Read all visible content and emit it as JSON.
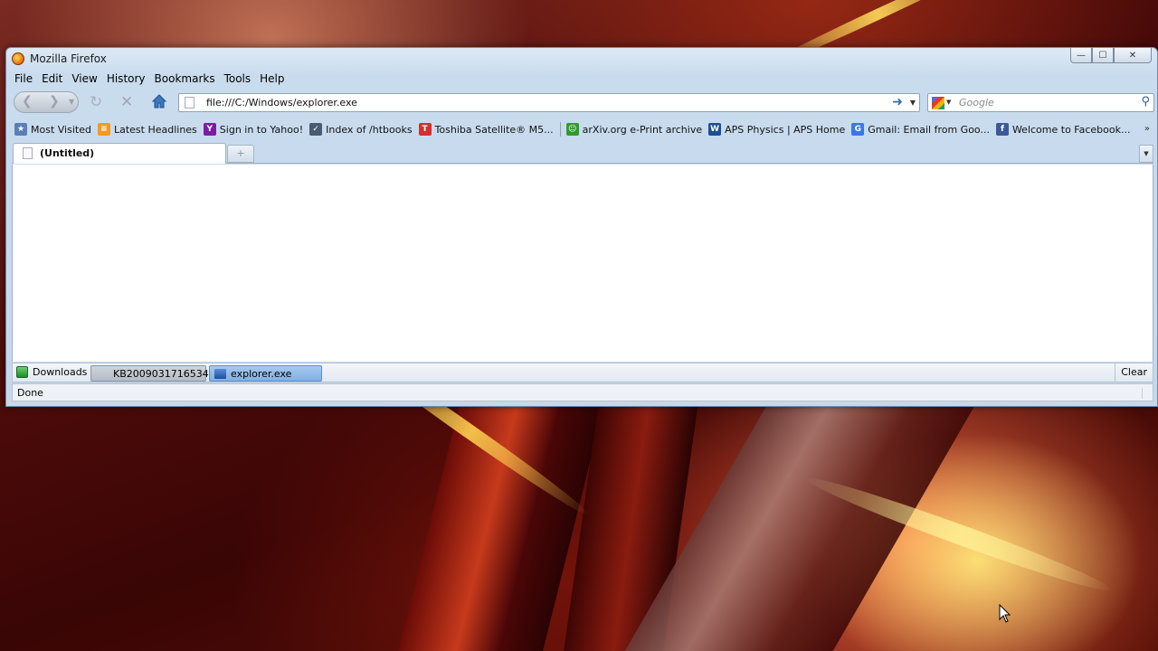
{
  "window": {
    "title": "Mozilla Firefox",
    "buttons": {
      "minimize": "—",
      "maximize": "☐",
      "close": "✕"
    }
  },
  "menu": [
    {
      "label": "File"
    },
    {
      "label": "Edit"
    },
    {
      "label": "View"
    },
    {
      "label": "History"
    },
    {
      "label": "Bookmarks"
    },
    {
      "label": "Tools"
    },
    {
      "label": "Help"
    }
  ],
  "navigation": {
    "url": "file:///C:/Windows/explorer.exe",
    "search_placeholder": "Google",
    "back_glyph": "❮",
    "forward_glyph": "❯",
    "reload_glyph": "↻",
    "stop_glyph": "✕",
    "go_glyph": "➜",
    "search_glyph": "⚲"
  },
  "bookmarks": [
    {
      "label": "Most Visited",
      "icon": "most-visited-icon",
      "color": "#5a7fb8",
      "glyph": "★"
    },
    {
      "label": "Latest Headlines",
      "icon": "rss-feed-icon",
      "color": "#f29a20",
      "glyph": "≡"
    },
    {
      "label": "Sign in to Yahoo!",
      "icon": "yahoo-icon",
      "color": "#7b1fa2",
      "glyph": "Y"
    },
    {
      "label": "Index of /htbooks",
      "icon": "folder-index-icon",
      "color": "#4a5a72",
      "glyph": "✓"
    },
    {
      "label": "Toshiba Satellite® M5...",
      "icon": "toshiba-icon",
      "color": "#d32f2f",
      "glyph": "T"
    },
    {
      "label": "arXiv.org e-Print archive",
      "icon": "arxiv-icon",
      "color": "#2e9b2e",
      "glyph": "☺"
    },
    {
      "label": "APS Physics | APS Home",
      "icon": "aps-icon",
      "color": "#1c4f96",
      "glyph": "W"
    },
    {
      "label": "Gmail: Email from Goo...",
      "icon": "gmail-icon",
      "color": "#3b78e7",
      "glyph": "G"
    },
    {
      "label": "Welcome to Facebook...",
      "icon": "facebook-icon",
      "color": "#3b5998",
      "glyph": "f"
    }
  ],
  "bookmarks_more": "»",
  "tabs": [
    {
      "label": "(Untitled)",
      "active": true
    }
  ],
  "new_tab_glyph": "+",
  "tab_list_glyph": "▼",
  "downloads": {
    "title": "Downloads",
    "items": [
      {
        "label": "KB2009031716534...",
        "state": "inactive"
      },
      {
        "label": "explorer.exe",
        "state": "active"
      }
    ],
    "clear_label": "Clear"
  },
  "status": "Done"
}
